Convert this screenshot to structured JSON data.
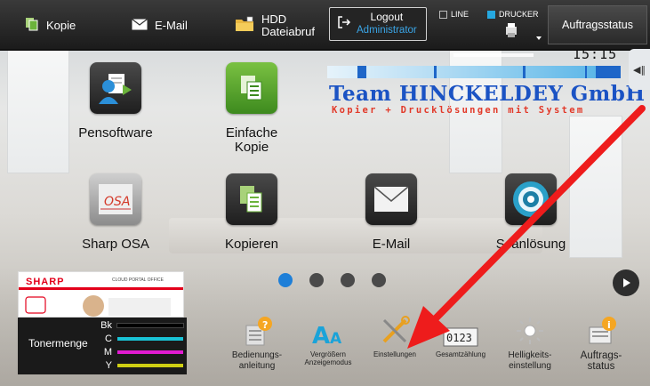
{
  "topbar": {
    "kopie_label": "Kopie",
    "email_label": "E-Mail",
    "hdd_line1": "HDD",
    "hdd_line2": "Dateiabruf",
    "logout_label": "Logout",
    "logout_user": "Administrator",
    "status_line": "LINE",
    "status_drucker": "DRUCKER",
    "jobstatus_label": "Auftragsstatus"
  },
  "clock": "15:15",
  "banner": {
    "title": "Team HINCKELDEY GmbH",
    "subtitle": "Kopier + Drucklösungen mit System"
  },
  "apps": [
    {
      "label": "Pensoftware",
      "icon": "pensoftware-icon"
    },
    {
      "label": "Einfache\nKopie",
      "icon": "simple-copy-icon"
    },
    {
      "label": "Sharp OSA",
      "icon": "sharp-osa-icon"
    },
    {
      "label": "Kopieren",
      "icon": "copy-icon"
    },
    {
      "label": "E-Mail",
      "icon": "email-icon"
    },
    {
      "label": "Scanlösung",
      "icon": "scan-solution-icon"
    }
  ],
  "pager": {
    "count": 4,
    "active": 1
  },
  "sharp_banner": {
    "logo": "SHARP",
    "portal": "CLOUD PORTAL OFFICE"
  },
  "toner": {
    "label": "Tonermenge",
    "levels": [
      {
        "code": "Bk",
        "color": "#000000"
      },
      {
        "code": "C",
        "color": "#19c3d6"
      },
      {
        "code": "M",
        "color": "#e11bd1"
      },
      {
        "code": "Y",
        "color": "#cfcf13"
      }
    ]
  },
  "shortcuts": [
    {
      "label": "Bedienungs-\nanleitung",
      "icon": "manual-icon"
    },
    {
      "label": "Vergrößern\nAnzeigemodus",
      "icon": "enlarge-display-icon"
    },
    {
      "label": "Einstellungen",
      "icon": "settings-tools-icon"
    },
    {
      "label": "Gesamtzählung",
      "icon": "counter-icon"
    },
    {
      "label": "Helligkeits-\neinstellung",
      "icon": "brightness-icon"
    },
    {
      "label": "Auftrags-\nstatus",
      "icon": "job-status-icon"
    }
  ],
  "counter_digits": "0123",
  "colors": {
    "accent_blue": "#1e7fd8",
    "annotation_red": "#ee1c1c",
    "company_blue": "#1b53c4",
    "company_red": "#e23a2a"
  }
}
